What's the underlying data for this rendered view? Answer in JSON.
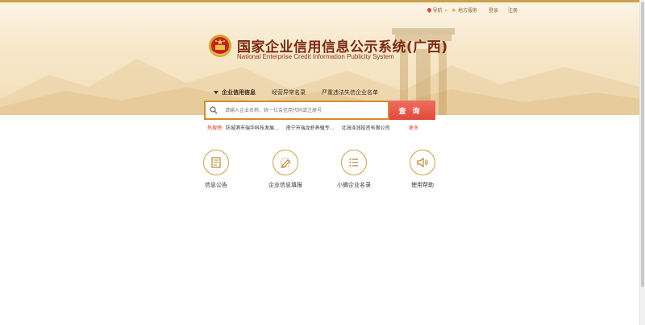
{
  "topnav": {
    "nav_label": "导航",
    "map_label": "地方服务",
    "login_label": "登录",
    "register_label": "注册"
  },
  "header": {
    "title_cn": "国家企业信用信息公示系统(广西)",
    "title_en": "National Enterprise Credit Information Publicity System"
  },
  "tabs": [
    {
      "label": "企业信用信息",
      "active": true
    },
    {
      "label": "经营异常名录",
      "active": false
    },
    {
      "label": "严重违法失信企业名单",
      "active": false
    }
  ],
  "search": {
    "placeholder": "请输入企业名称、统一社会信用代码或注册号",
    "button_label": "查询"
  },
  "hot": {
    "label": "热搜榜:",
    "items": [
      "防城港市瑞华科技发展...",
      "南宁市瑞龙虾养殖专...",
      "北海泽润投资有限公司"
    ],
    "more_label": "更多"
  },
  "features": [
    {
      "label": "信息公告",
      "icon": "document-icon"
    },
    {
      "label": "企业信息填报",
      "icon": "pen-icon"
    },
    {
      "label": "小微企业名录",
      "icon": "list-icon"
    },
    {
      "label": "使用帮助",
      "icon": "speaker-icon"
    }
  ],
  "colors": {
    "accent_gold": "#c9a24a",
    "title_red": "#7a2a12",
    "button_red": "#e04a3c",
    "hot_red": "#e0392b"
  }
}
